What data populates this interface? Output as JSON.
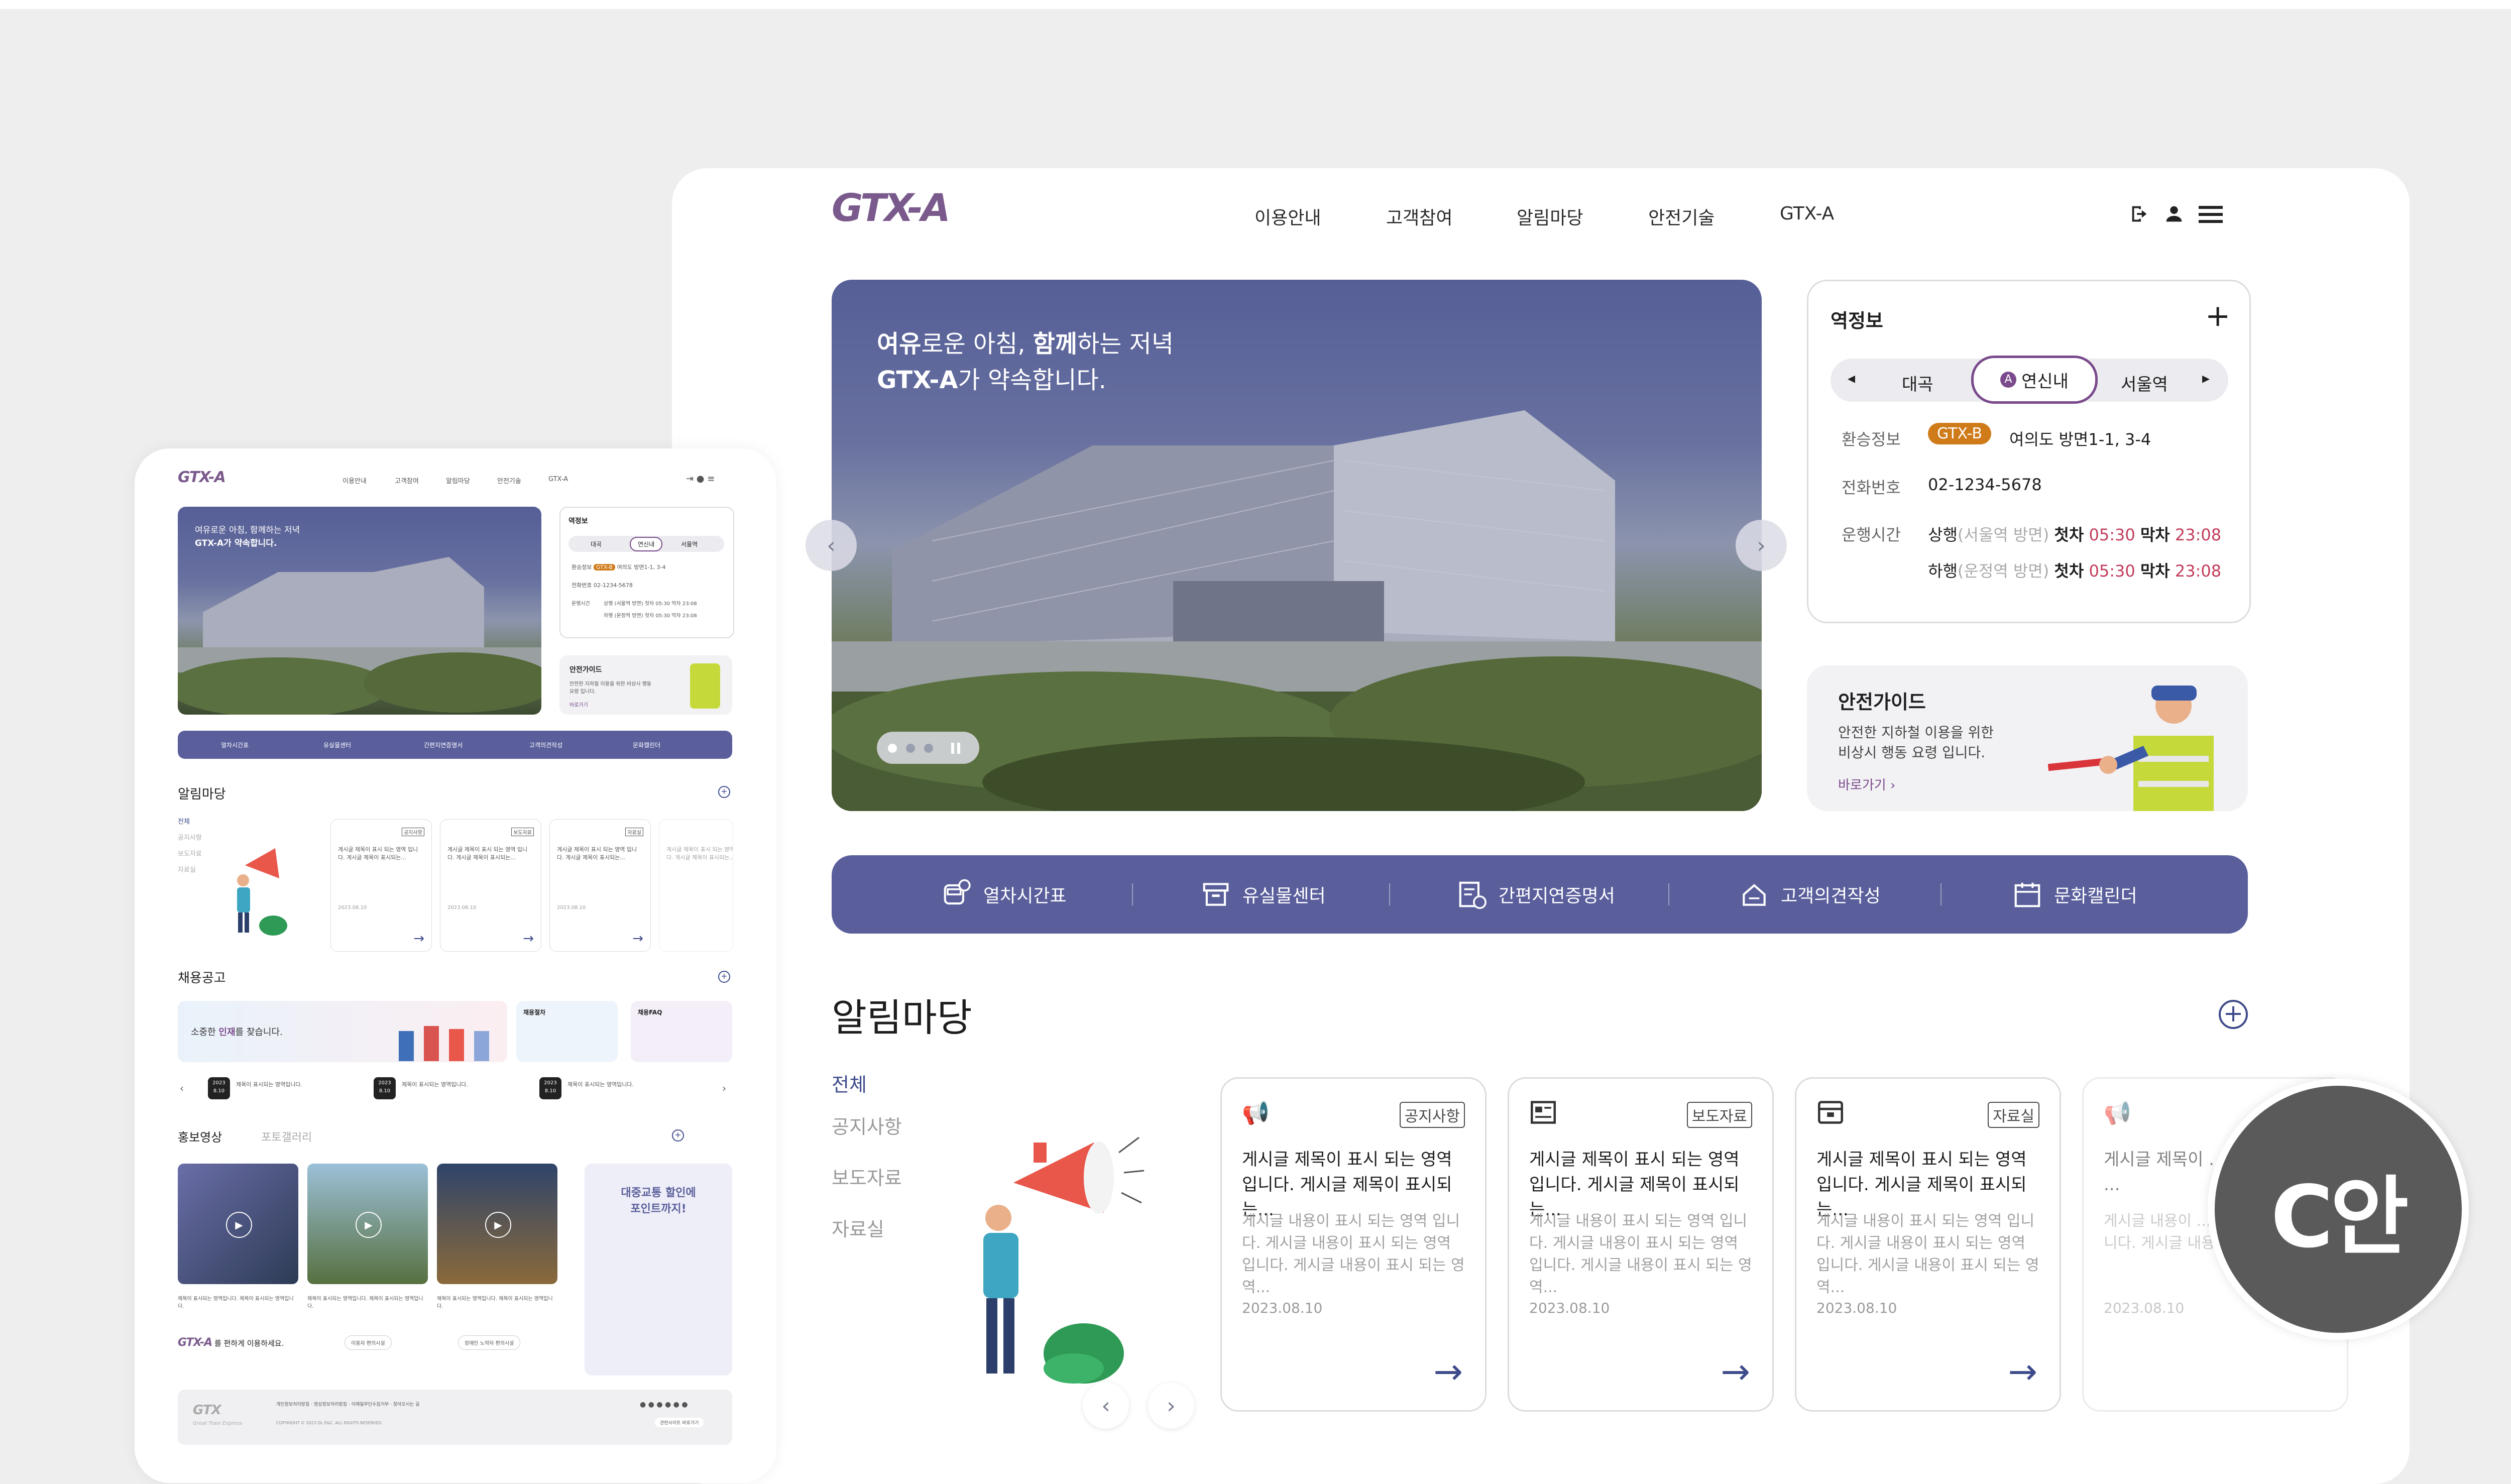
{
  "desktop": {
    "logo": "GTX-A",
    "nav": [
      "이용안내",
      "고객참여",
      "알림마당",
      "안전기술",
      "GTX-A"
    ],
    "hero": {
      "line1_bold1": "여유",
      "line1_rest1": "로운 아침, ",
      "line1_bold2": "함께",
      "line1_rest2": "하는 저녁",
      "line2_bold": "GTX-A",
      "line2_rest": "가 약속합니다."
    },
    "station": {
      "title": "역정보",
      "prev": "대곡",
      "current": "연신내",
      "current_badge": "A",
      "next": "서울역",
      "transfer_label": "환승정보",
      "transfer_line": "GTX-B",
      "transfer_text": "여의도 방면1-1, 3-4",
      "phone_label": "전화번호",
      "phone": "02-1234-5678",
      "hours_label": "운행시간",
      "up_label": "상행",
      "up_dir": "(서울역 방면)",
      "down_label": "하행",
      "down_dir": "(운정역 방면)",
      "first_label": "첫차",
      "last_label": "막차",
      "up_first": "05:30",
      "up_last": "23:08",
      "down_first": "05:30",
      "down_last": "23:08"
    },
    "safety": {
      "title": "안전가이드",
      "desc1": "안전한 지하철 이용을 위한",
      "desc2": "비상시 행동 요령 입니다.",
      "link": "바로가기"
    },
    "quick_menu": [
      "열차시간표",
      "유실물센터",
      "간편지연증명서",
      "고객의견작성",
      "문화캘린더"
    ],
    "notice": {
      "title": "알림마당",
      "tabs": [
        "전체",
        "공지사항",
        "보도자료",
        "자료실"
      ],
      "cards": [
        {
          "badge": "공지사항",
          "title": "게시글 제목이 표시 되는 영역 입니다. 게시글 제목이 표시되는...",
          "body": "게시글 내용이 표시 되는 영역 입니다. 게시글 내용이 표시 되는 영역 입니다. 게시글 내용이 표시 되는 영역...",
          "date": "2023.08.10"
        },
        {
          "badge": "보도자료",
          "title": "게시글 제목이 표시 되는 영역 입니다. 게시글 제목이 표시되는...",
          "body": "게시글 내용이 표시 되는 영역 입니다. 게시글 내용이 표시 되는 영역 입니다. 게시글 내용이 표시 되는 영역...",
          "date": "2023.08.10"
        },
        {
          "badge": "자료실",
          "title": "게시글 제목이 표시 되는 영역 입니다. 게시글 제목이 표시되는...",
          "body": "게시글 내용이 표시 되는 영역 입니다. 게시글 내용이 표시 되는 영역 입니다. 게시글 내용이 표시 되는 영역...",
          "date": "2023.08.10"
        },
        {
          "badge": "",
          "title": "게시글 제목이 ...니다. 게시글 ...",
          "body": "게시글 내용이 ...다. 게시글 내용...니다. 게시글 내용...",
          "date": "2023.08.10"
        }
      ]
    }
  },
  "mobile": {
    "logo": "GTX-A",
    "nav": [
      "이용안내",
      "고객참여",
      "알림마당",
      "안전기술",
      "GTX-A"
    ],
    "hero_line1": "여유로운 아침, 함께하는 저녁",
    "hero_line2": "GTX-A가 약속합니다.",
    "station_title": "역정보",
    "station_prev": "대곡",
    "station_current": "연신내",
    "station_next": "서울역",
    "transfer_label": "환승정보",
    "transfer_line": "GTX-B",
    "transfer_text": "여의도 방면1-1, 3-4",
    "phone_label": "전화번호",
    "phone": "02-1234-5678",
    "hours_label": "운행시간",
    "hours_up": "상행 (서울역 방면) 첫차 05:30 막차 23:08",
    "hours_down": "하행 (운정역 방면) 첫차 05:30 막차 23:08",
    "safety_title": "안전가이드",
    "safety_desc": "안전한 지하철 이용을 위한 비상시 행동 요령 입니다.",
    "safety_link": "바로가기",
    "quick_menu": [
      "열차시간표",
      "유실물센터",
      "간편지연증명서",
      "고객의견작성",
      "문화캘린더"
    ],
    "notice_title": "알림마당",
    "notice_tabs": [
      "전체",
      "공지사항",
      "보도자료",
      "자료실"
    ],
    "notice_card_badges": [
      "공지사항",
      "보도자료",
      "자료실",
      ""
    ],
    "notice_card_title": "게시글 제목이 표시 되는 영역 입니다. 게시글 제목이 표시되는...",
    "notice_card_date": "2023.08.10",
    "recruit_title": "채용공고",
    "recruit_banner_a": "소중한 ",
    "recruit_banner_b": "인재",
    "recruit_banner_c": "를 찾습니다.",
    "recruit_box1_title": "채용절차",
    "recruit_box2_title": "채용FAQ",
    "recruit_list": [
      {
        "year": "2023",
        "day": "8.10",
        "title": "제목이 표시되는 영역입니다."
      },
      {
        "year": "2023",
        "day": "8.10",
        "title": "제목이 표시되는 영역입니다."
      },
      {
        "year": "2023",
        "day": "8.10",
        "title": "제목이 표시되는 영역입니다."
      }
    ],
    "video_tab_active": "홍보영상",
    "video_tab_other": "포토갤러리",
    "video_caption": "제목이 표시되는 영역입니다. 제목이 표시되는 영역입니다.",
    "promo_line1": "대중교통 할인에",
    "promo_line2": "포인트까지!",
    "brand_text": "를 편하게 이용하세요.",
    "brand_btn1": "이용자 편의시설",
    "brand_btn2": "장애인 노약자 편의시설",
    "footer_logo": "GTX",
    "footer_sub": "Great Train Express",
    "footer_links": [
      "개인정보처리방침",
      "영상정보처리방침",
      "이메일무단수집거부",
      "찾아오시는 길"
    ],
    "footer_copy": "COPYRIGHT © 2023 DL E&C. ALL RIGHTS RESERVED.",
    "footer_family": "관련사이트 바로가기"
  },
  "badge": "C안",
  "colors": {
    "primary": "#5a5f9c",
    "accent_purple": "#7a4a8c",
    "gtxb_orange": "#cf7b1a",
    "logo": "#7a5a8c",
    "red_time": "#c23b5a"
  }
}
